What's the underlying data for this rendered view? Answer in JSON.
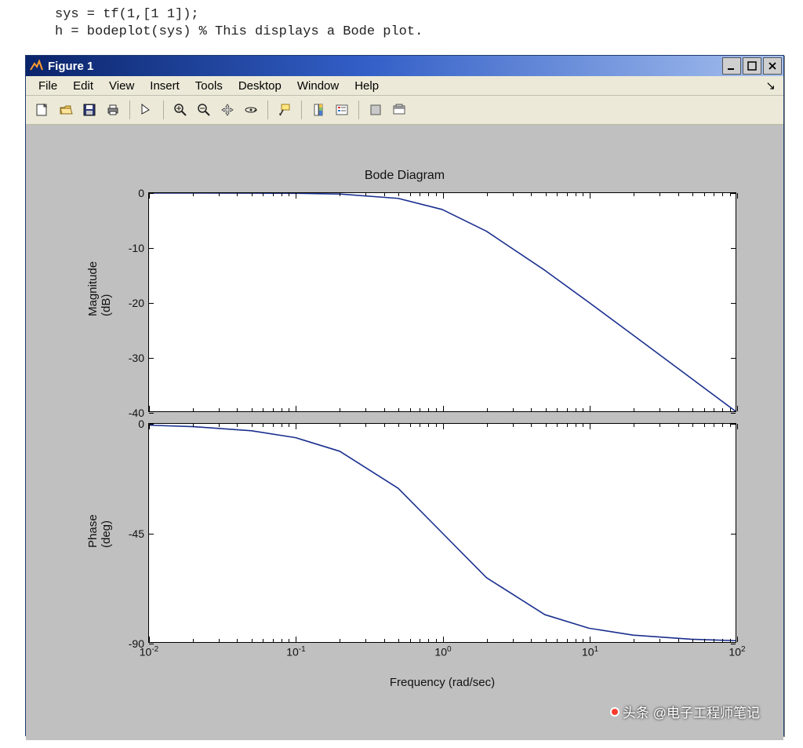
{
  "code": {
    "line1": "sys = tf(1,[1 1]);",
    "line2": "h = bodeplot(sys) % This displays a Bode plot."
  },
  "window": {
    "title": "Figure 1"
  },
  "menubar": [
    "File",
    "Edit",
    "View",
    "Insert",
    "Tools",
    "Desktop",
    "Window",
    "Help"
  ],
  "chart_data": [
    {
      "type": "line",
      "title": "Bode Diagram",
      "xlabel": "Frequency  (rad/sec)",
      "ylabel": "Magnitude (dB)",
      "x_scale": "log",
      "xlim": [
        0.01,
        100
      ],
      "ylim": [
        -40,
        0
      ],
      "yticks": [
        0,
        -10,
        -20,
        -30,
        -40
      ],
      "xticks": [
        0.01,
        0.1,
        1,
        10,
        100
      ],
      "x": [
        0.01,
        0.02,
        0.05,
        0.1,
        0.2,
        0.5,
        1,
        2,
        5,
        10,
        20,
        50,
        100
      ],
      "values": [
        0.0,
        -0.002,
        -0.011,
        -0.043,
        -0.17,
        -0.969,
        -3.01,
        -6.99,
        -14.15,
        -20.04,
        -26.03,
        -33.98,
        -40.0
      ]
    },
    {
      "type": "line",
      "title": "",
      "xlabel": "Frequency  (rad/sec)",
      "ylabel": "Phase (deg)",
      "x_scale": "log",
      "xlim": [
        0.01,
        100
      ],
      "ylim": [
        -90,
        0
      ],
      "yticks": [
        0,
        -45,
        -90
      ],
      "xticks": [
        0.01,
        0.1,
        1,
        10,
        100
      ],
      "x": [
        0.01,
        0.02,
        0.05,
        0.1,
        0.2,
        0.5,
        1,
        2,
        5,
        10,
        20,
        50,
        100
      ],
      "values": [
        -0.573,
        -1.146,
        -2.862,
        -5.711,
        -11.31,
        -26.57,
        -45.0,
        -63.43,
        -78.69,
        -84.29,
        -87.14,
        -88.85,
        -89.43
      ]
    }
  ],
  "watermark": "头条 @电子工程师笔记"
}
